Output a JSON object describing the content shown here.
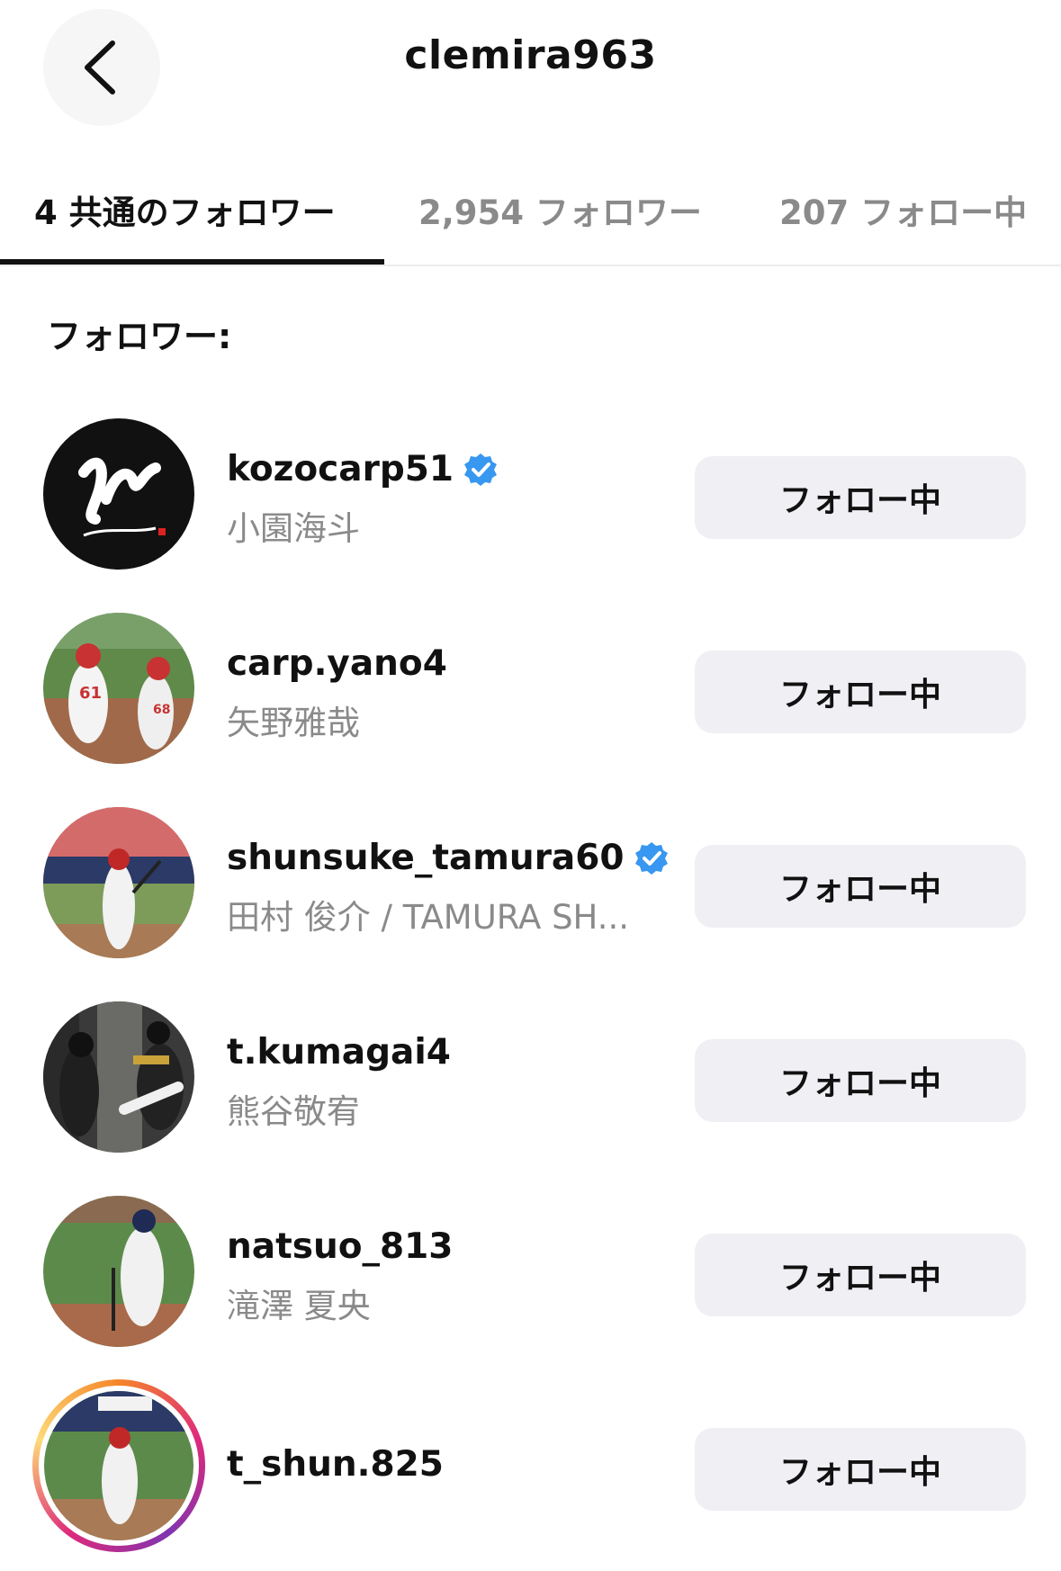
{
  "header": {
    "back_icon": "chevron-left-icon",
    "title": "clemira963"
  },
  "tabs": [
    {
      "label": "4 共通のフォロワー",
      "active": true
    },
    {
      "label": "2,954 フォロワー",
      "active": false
    },
    {
      "label": "207 フォロー中",
      "active": false
    }
  ],
  "section_label": "フォロワー:",
  "users": [
    {
      "username": "kozocarp51",
      "full_name": "小園海斗",
      "verified": true,
      "button": "フォロー中"
    },
    {
      "username": "carp.yano4",
      "full_name": "矢野雅哉",
      "verified": false,
      "button": "フォロー中"
    },
    {
      "username": "shunsuke_tamura60",
      "full_name": "田村 俊介 / TAMURA SH...",
      "verified": true,
      "button": "フォロー中"
    },
    {
      "username": "t.kumagai4",
      "full_name": "熊谷敬宥",
      "verified": false,
      "button": "フォロー中"
    },
    {
      "username": "natsuo_813",
      "full_name": "滝澤 夏央",
      "verified": false,
      "button": "フォロー中"
    },
    {
      "username": "t_shun.825",
      "full_name": "",
      "verified": false,
      "has_story": true,
      "button": "フォロー中"
    }
  ],
  "colors": {
    "verified_badge": "#3897f0",
    "button_bg": "#efeff4",
    "secondary_text": "#8a8a8a"
  }
}
